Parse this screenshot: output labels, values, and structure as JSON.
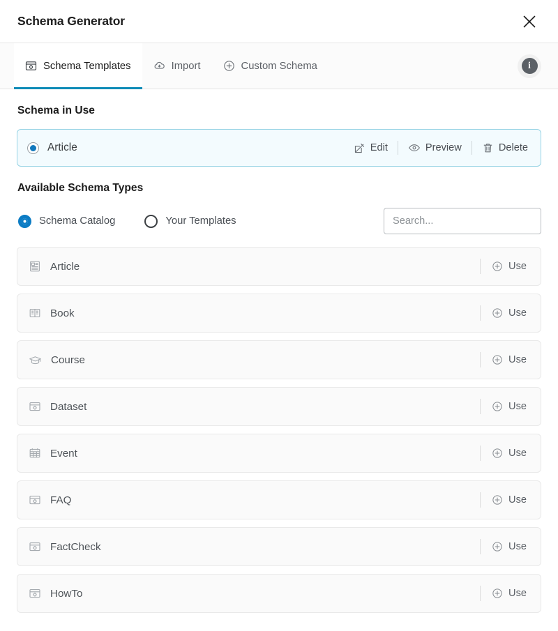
{
  "header": {
    "title": "Schema Generator",
    "close_label": "Close",
    "close_icon": "close-icon"
  },
  "tabs": {
    "items": [
      {
        "label": "Schema Templates",
        "icon": "window-gear-icon",
        "active": true
      },
      {
        "label": "Import",
        "icon": "cloud-download-icon",
        "active": false
      },
      {
        "label": "Custom Schema",
        "icon": "plus-circle-icon",
        "active": false
      }
    ],
    "info_icon": "info-icon",
    "info_label": "i",
    "active_underline_color": "#0e8bb7"
  },
  "schema_in_use": {
    "section_title": "Schema in Use",
    "name": "Article",
    "selected": true,
    "border_color": "#96d3e4",
    "background_color": "#f3fbfe",
    "radio_color": "#1178bd",
    "actions": [
      {
        "label": "Edit",
        "icon": "edit-pencil-icon"
      },
      {
        "label": "Preview",
        "icon": "eye-icon"
      },
      {
        "label": "Delete",
        "icon": "trash-icon"
      }
    ]
  },
  "available": {
    "section_title": "Available Schema Types",
    "filters": [
      {
        "label": "Schema Catalog",
        "selected": true
      },
      {
        "label": "Your Templates",
        "selected": false
      }
    ],
    "selected_radio_color": "#0c7cc4",
    "search": {
      "placeholder": "Search...",
      "value": ""
    },
    "use_label": "Use",
    "use_icon": "plus-circle-icon",
    "rows": [
      {
        "label": "Article",
        "icon": "article-icon"
      },
      {
        "label": "Book",
        "icon": "book-icon"
      },
      {
        "label": "Course",
        "icon": "graduation-cap-icon"
      },
      {
        "label": "Dataset",
        "icon": "window-gear-icon"
      },
      {
        "label": "Event",
        "icon": "calendar-icon"
      },
      {
        "label": "FAQ",
        "icon": "window-gear-icon"
      },
      {
        "label": "FactCheck",
        "icon": "window-gear-icon"
      },
      {
        "label": "HowTo",
        "icon": "window-gear-icon"
      }
    ]
  }
}
